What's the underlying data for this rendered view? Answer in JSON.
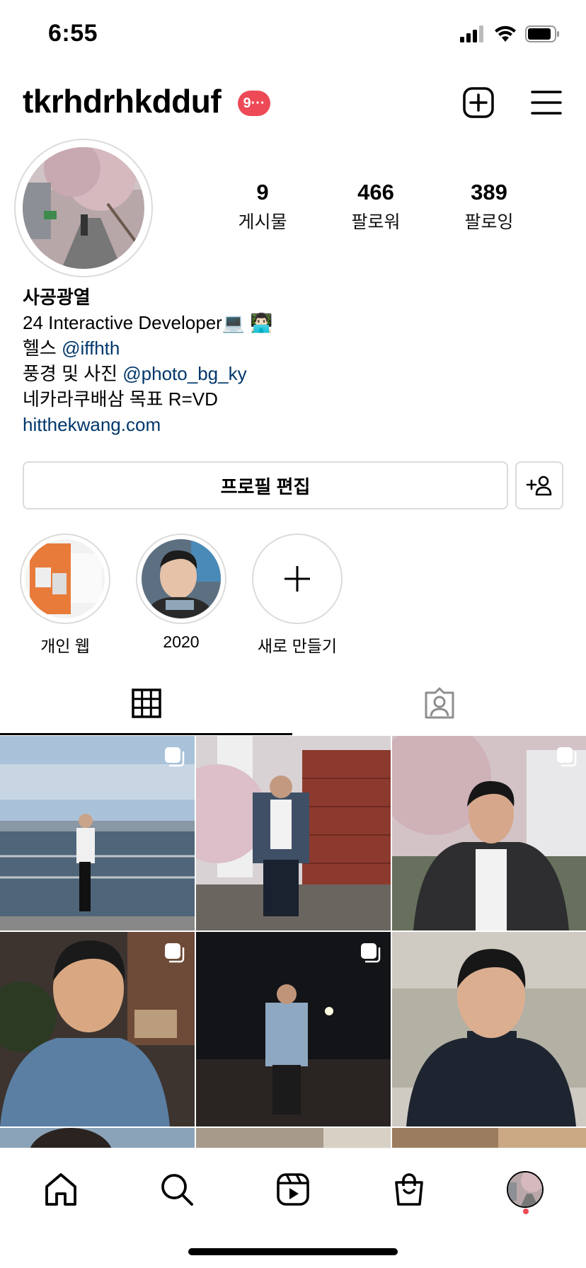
{
  "status_bar": {
    "time": "6:55"
  },
  "header": {
    "username": "tkrhdrhkdduf",
    "notification_badge": "9···"
  },
  "stats": {
    "posts": {
      "count": "9",
      "label": "게시물"
    },
    "followers": {
      "count": "466",
      "label": "팔로워"
    },
    "following": {
      "count": "389",
      "label": "팔로잉"
    }
  },
  "bio": {
    "name": "사공광열",
    "line1": "24 Interactive Developer💻 👨🏻‍💻",
    "line2_prefix": "헬스 ",
    "line2_mention": "@iffhth",
    "line3_prefix": "풍경 및 사진 ",
    "line3_mention": "@photo_bg_ky",
    "line4": "네카라쿠배삼 목표 R=VD",
    "website": "hitthekwang.com"
  },
  "buttons": {
    "edit_profile": "프로필 편집"
  },
  "highlights": [
    {
      "label": "개인 웹"
    },
    {
      "label": "2020"
    },
    {
      "label": "새로 만들기"
    }
  ],
  "colors": {
    "badge_red": "#ed4956",
    "link_blue": "#00376b",
    "border_gray": "#dbdbdb"
  },
  "icons": {
    "header": [
      "add-post-icon",
      "menu-icon"
    ],
    "tabs": [
      "grid-icon",
      "tagged-icon"
    ],
    "nav": [
      "home-icon",
      "search-icon",
      "reels-icon",
      "shop-icon",
      "profile-avatar"
    ]
  }
}
